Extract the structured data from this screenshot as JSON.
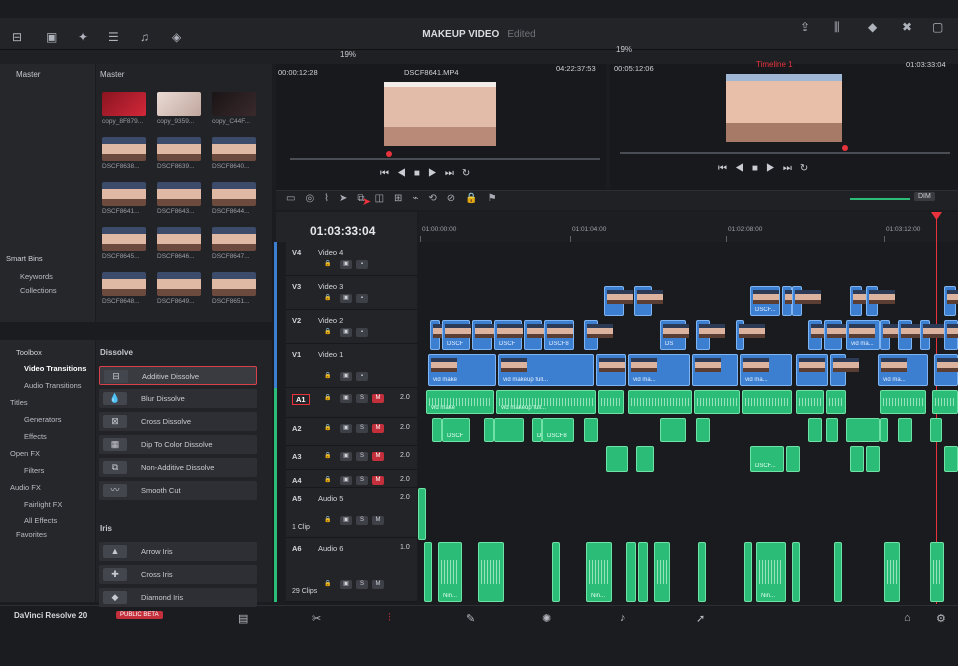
{
  "app": {
    "project_title": "MAKEUP VIDEO",
    "status": "Edited",
    "name": "DaVinci Resolve 20",
    "badge": "PUBLIC BETA"
  },
  "colors": {
    "accent_red": "#d8414c",
    "video_clip": "#3c7fd1",
    "audio_clip": "#2bbd78",
    "playhead": "#e8323c"
  },
  "media_pool": {
    "header_left": "Master",
    "header_right": "Master",
    "zoom": "19%",
    "clips": [
      "copy_8F879...",
      "copy_9359...",
      "copy_C44F...",
      "DSCF8638...",
      "DSCF8639...",
      "DSCF8640...",
      "DSCF8641...",
      "DSCF8643...",
      "DSCF8644...",
      "DSCF8645...",
      "DSCF8646...",
      "DSCF8647...",
      "DSCF8648...",
      "DSCF8649...",
      "DSCF8651..."
    ],
    "smart_bins": "Smart Bins",
    "keywords": "Keywords",
    "collections": "Collections"
  },
  "effects": {
    "toolbox": "Toolbox",
    "items": [
      "Video Transitions",
      "Audio Transitions",
      "Titles",
      "Generators",
      "Effects",
      "Open FX",
      "Filters",
      "Audio FX",
      "Fairlight FX",
      "All Effects",
      "Favorites"
    ],
    "dissolve_header": "Dissolve",
    "dissolves": [
      "Additive Dissolve",
      "Blur Dissolve",
      "Cross Dissolve",
      "Dip To Color Dissolve",
      "Non-Additive Dissolve",
      "Smooth Cut"
    ],
    "iris_header": "Iris",
    "iris": [
      "Arrow Iris",
      "Cross Iris",
      "Diamond Iris"
    ]
  },
  "source_viewer": {
    "timecode_left": "00:00:12:28",
    "clip_name": "DSCF8641.MP4",
    "timecode_right": "04:22:37:53"
  },
  "timeline_viewer": {
    "zoom": "19%",
    "timecode_left": "00:05:12:06",
    "timeline_name": "Timeline 1",
    "timecode_right": "01:03:33:04"
  },
  "timeline": {
    "current_timecode": "01:03:33:04",
    "dim_label": "DIM",
    "ruler": [
      "01:00:00:00",
      "01:01:04:00",
      "01:02:08:00",
      "01:03:12:00"
    ],
    "tracks": [
      {
        "id": "V4",
        "name": "Video 4"
      },
      {
        "id": "V3",
        "name": "Video 3"
      },
      {
        "id": "V2",
        "name": "Video 2"
      },
      {
        "id": "V1",
        "name": "Video 1"
      },
      {
        "id": "A1",
        "name": "",
        "level": "2.0"
      },
      {
        "id": "A2",
        "name": "",
        "level": "2.0"
      },
      {
        "id": "A3",
        "name": "",
        "level": "2.0"
      },
      {
        "id": "A4",
        "name": "",
        "level": "2.0"
      },
      {
        "id": "A5",
        "name": "Audio 5",
        "level": "2.0",
        "clips": "1 Clip"
      },
      {
        "id": "A6",
        "name": "Audio 6",
        "level": "1.0",
        "clips": "29 Clips"
      }
    ],
    "clip_names": {
      "v3": "DSCF...",
      "v2a": "DSCF",
      "v2b": "DSCF",
      "v2c": "DSCF8",
      "v2d": "DS",
      "v2e": "vid ma...",
      "v1a": "vid make",
      "v1b": "vid makeup full...",
      "v1c": "vid ma...",
      "v1d": "vid ma...",
      "v1e": "vid ma...",
      "a1a": "vid make",
      "a1b": "vid makeup full...",
      "a2a": "DSCF",
      "a2b": "DSCF",
      "a2c": "DSCF8",
      "a3": "DSCF...",
      "a6": "Nin..."
    },
    "track_buttons": {
      "solo": "S",
      "mute": "M"
    }
  }
}
